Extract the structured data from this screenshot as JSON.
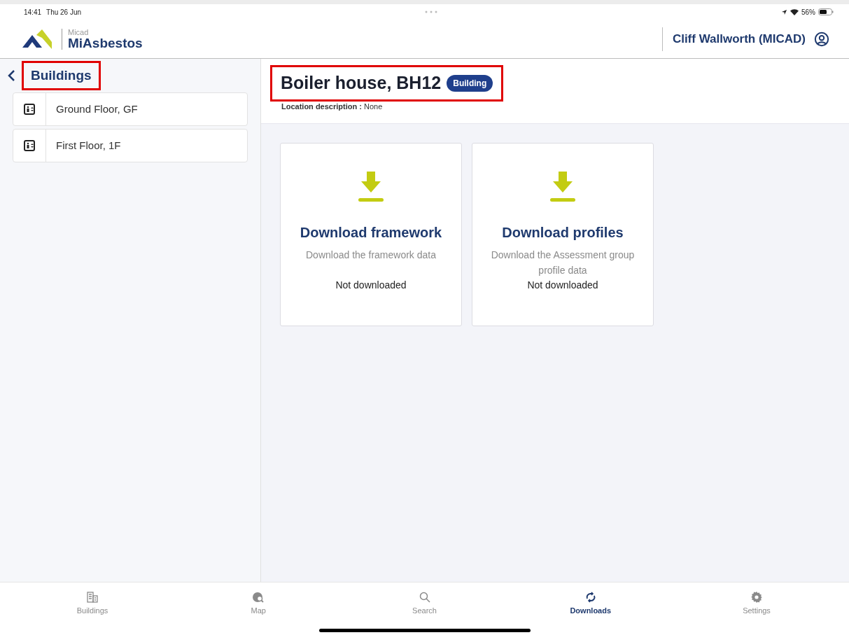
{
  "status_bar": {
    "time": "14:41",
    "date": "Thu 26 Jun",
    "battery": "56%"
  },
  "app_header": {
    "logo_small": "Micad",
    "logo_name": "MiAsbestos",
    "user": "Cliff Wallworth (MICAD)"
  },
  "sidebar": {
    "title": "Buildings",
    "highlighted": true,
    "items": [
      {
        "label": "Ground Floor, GF"
      },
      {
        "label": "First Floor, 1F"
      }
    ]
  },
  "page": {
    "title": "Boiler house, BH12",
    "badge": "Building",
    "highlighted": true,
    "description_label": "Location description :",
    "description_value": "None"
  },
  "cards": [
    {
      "title": "Download framework",
      "description": "Download the framework data",
      "status": "Not downloaded"
    },
    {
      "title": "Download profiles",
      "description": "Download the Assessment group profile data",
      "status": "Not downloaded"
    }
  ],
  "tab_bar": [
    {
      "kind": "buildings",
      "label": "Buildings",
      "selected": false
    },
    {
      "kind": "map",
      "label": "Map",
      "selected": false
    },
    {
      "kind": "search",
      "label": "Search",
      "selected": false
    },
    {
      "kind": "downloads",
      "label": "Downloads",
      "selected": true
    },
    {
      "kind": "settings",
      "label": "Settings",
      "selected": false
    }
  ]
}
